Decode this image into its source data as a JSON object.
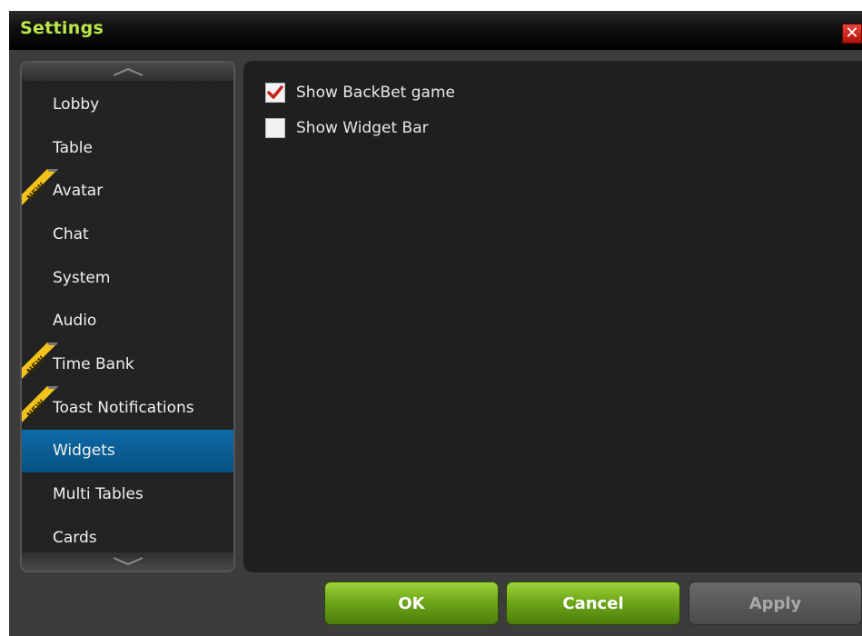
{
  "window": {
    "title": "Settings",
    "close_glyph": "✕"
  },
  "sidebar": {
    "items": [
      {
        "label": "Lobby",
        "new": false,
        "active": false
      },
      {
        "label": "Table",
        "new": false,
        "active": false
      },
      {
        "label": "Avatar",
        "new": true,
        "active": false
      },
      {
        "label": "Chat",
        "new": false,
        "active": false
      },
      {
        "label": "System",
        "new": false,
        "active": false
      },
      {
        "label": "Audio",
        "new": false,
        "active": false
      },
      {
        "label": "Time Bank",
        "new": true,
        "active": false
      },
      {
        "label": "Toast Notifications",
        "new": true,
        "active": false
      },
      {
        "label": "Widgets",
        "new": false,
        "active": true
      },
      {
        "label": "Multi Tables",
        "new": false,
        "active": false
      },
      {
        "label": "Cards",
        "new": false,
        "active": false
      }
    ],
    "new_badge_text": "NEW"
  },
  "options": [
    {
      "label": "Show BackBet game",
      "checked": true
    },
    {
      "label": "Show Widget Bar",
      "checked": false
    }
  ],
  "buttons": {
    "ok": "OK",
    "cancel": "Cancel",
    "apply": "Apply"
  },
  "colors": {
    "title": "#b9e84a",
    "active_item": "#0d6aa8",
    "check_mark": "#c8201a",
    "button_green": "#6fa81a"
  }
}
